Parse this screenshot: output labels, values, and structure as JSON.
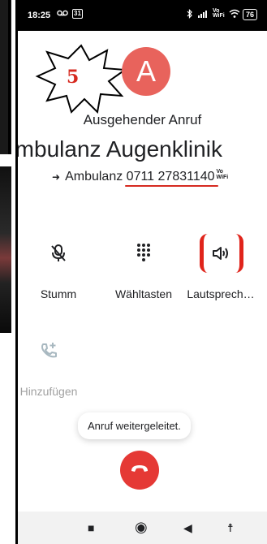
{
  "status_bar": {
    "time": "18:25",
    "icons_left": [
      "voicemail-icon",
      "calendar-31-icon"
    ],
    "calendar_day": "31",
    "icons_right": [
      "bluetooth-icon",
      "signal-icon",
      "vowifi-icon",
      "wifi-icon"
    ],
    "vowifi_text": "Vo\nWiFi",
    "battery": "76"
  },
  "call": {
    "avatar_letter": "A",
    "status": "Ausgehender Anruf",
    "contact_name": "Ambulanz Augenklinik",
    "number_label": "Ambulanz",
    "number": "0711 27831140",
    "vowifi_badge": "Vo WiFi"
  },
  "annotation": {
    "step_number": "5",
    "color": "#d62a20"
  },
  "actions": {
    "mute": "Stumm",
    "keypad": "Wähltasten",
    "speaker": "Lautsprech…",
    "add": "Hinzufügen"
  },
  "toast": "Anruf weitergeleitet.",
  "colors": {
    "avatar": "#e8635c",
    "end_call": "#e53935",
    "highlight": "#e0241b"
  },
  "nav": [
    "square-icon",
    "circle-icon",
    "triangle-back-icon",
    "accessibility-icon"
  ]
}
